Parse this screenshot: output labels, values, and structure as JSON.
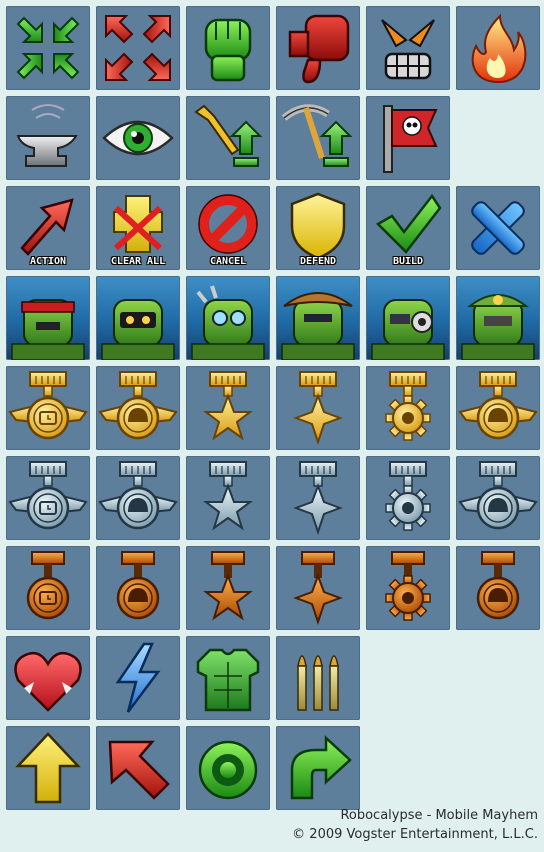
{
  "sheet": {
    "background": "#dff0ef",
    "tile_color": "#5d7f9b",
    "rows": [
      {
        "tiles": [
          {
            "icon": "shrink-arrows-icon"
          },
          {
            "icon": "expand-arrows-icon"
          },
          {
            "icon": "green-fist-icon"
          },
          {
            "icon": "thumbs-down-icon"
          },
          {
            "icon": "angry-robot-face-icon"
          },
          {
            "icon": "fire-icon"
          }
        ]
      },
      {
        "tiles": [
          {
            "icon": "anvil-icon"
          },
          {
            "icon": "eye-icon"
          },
          {
            "icon": "wrench-upgrade-icon"
          },
          {
            "icon": "pickaxe-upgrade-icon"
          },
          {
            "icon": "skull-flag-icon"
          }
        ]
      },
      {
        "tiles": [
          {
            "icon": "action-arrow-icon",
            "caption": "ACTION"
          },
          {
            "icon": "clear-all-icon",
            "caption": "CLEAR ALL"
          },
          {
            "icon": "cancel-icon",
            "caption": "CANCEL"
          },
          {
            "icon": "defend-shield-icon",
            "caption": "DEFEND"
          },
          {
            "icon": "build-check-icon",
            "caption": "BUILD"
          },
          {
            "icon": "x-mark-icon"
          }
        ]
      },
      {
        "tiles": [
          {
            "icon": "bandana-robot-portrait"
          },
          {
            "icon": "tank-robot-portrait"
          },
          {
            "icon": "spiked-robot-portrait"
          },
          {
            "icon": "cowboy-robot-portrait"
          },
          {
            "icon": "cannon-robot-portrait"
          },
          {
            "icon": "general-robot-portrait"
          }
        ]
      },
      {
        "tiles": [
          {
            "icon": "gold-winged-clock-medal-icon"
          },
          {
            "icon": "gold-winged-helmet-medal-icon"
          },
          {
            "icon": "gold-star-medal-icon"
          },
          {
            "icon": "gold-cross-medal-icon"
          },
          {
            "icon": "gold-gear-medal-icon"
          },
          {
            "icon": "gold-winged-helmet-medal-icon"
          }
        ]
      },
      {
        "tiles": [
          {
            "icon": "silver-winged-clock-medal-icon"
          },
          {
            "icon": "silver-winged-helmet-medal-icon"
          },
          {
            "icon": "silver-star-medal-icon"
          },
          {
            "icon": "silver-cross-medal-icon"
          },
          {
            "icon": "silver-gear-medal-icon"
          },
          {
            "icon": "silver-winged-helmet-medal-icon"
          }
        ]
      },
      {
        "tiles": [
          {
            "icon": "bronze-clock-medal-icon"
          },
          {
            "icon": "bronze-helmet-medal-icon"
          },
          {
            "icon": "bronze-star-medal-icon"
          },
          {
            "icon": "bronze-cross-medal-icon"
          },
          {
            "icon": "bronze-gear-medal-icon"
          },
          {
            "icon": "bronze-helmet-medal-icon"
          }
        ]
      },
      {
        "tiles": [
          {
            "icon": "heart-icon"
          },
          {
            "icon": "lightning-icon"
          },
          {
            "icon": "armor-vest-icon"
          },
          {
            "icon": "ammo-icon"
          }
        ]
      },
      {
        "tiles": [
          {
            "icon": "yellow-up-arrow-icon"
          },
          {
            "icon": "red-diagonal-arrow-icon"
          },
          {
            "icon": "green-target-icon"
          },
          {
            "icon": "green-u-turn-arrow-icon"
          }
        ]
      }
    ]
  },
  "credits": {
    "line1": "Robocalypse - Mobile Mayhem",
    "line2": "© 2009 Vogster Entertainment, L.L.C."
  }
}
